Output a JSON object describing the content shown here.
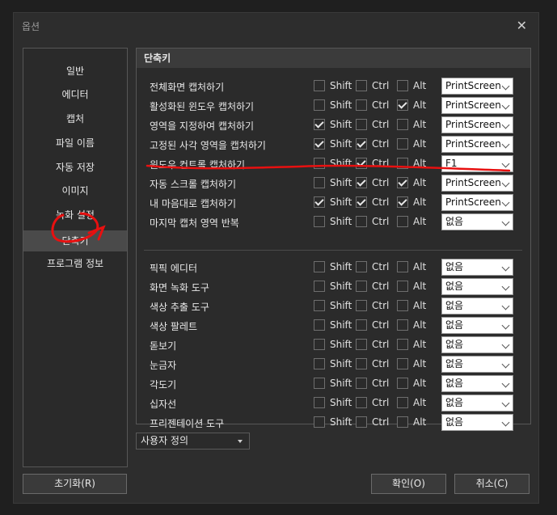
{
  "window": {
    "title": "옵션",
    "close_glyph": "✕"
  },
  "sidebar": {
    "items": [
      {
        "label": "일반",
        "active": false
      },
      {
        "label": "에디터",
        "active": false
      },
      {
        "label": "캡처",
        "active": false
      },
      {
        "label": "파일 이름",
        "active": false
      },
      {
        "label": "자동 저장",
        "active": false
      },
      {
        "label": "이미지",
        "active": false
      },
      {
        "label": "녹화 설정",
        "active": false
      },
      {
        "label": "단축키",
        "active": true
      },
      {
        "label": "프로그램 정보",
        "active": false
      }
    ]
  },
  "panel": {
    "title": "단축키",
    "modifier_labels": {
      "shift": "Shift",
      "ctrl": "Ctrl",
      "alt": "Alt"
    },
    "capture_rows": [
      {
        "label": "전체화면 캡처하기",
        "shift": false,
        "ctrl": false,
        "alt": false,
        "key": "PrintScreen"
      },
      {
        "label": "활성화된 윈도우 캡처하기",
        "shift": false,
        "ctrl": false,
        "alt": true,
        "key": "PrintScreen"
      },
      {
        "label": "영역을 지정하여 캡처하기",
        "shift": true,
        "ctrl": false,
        "alt": false,
        "key": "PrintScreen"
      },
      {
        "label": "고정된 사각 영역을 캡처하기",
        "shift": true,
        "ctrl": true,
        "alt": false,
        "key": "PrintScreen"
      },
      {
        "label": "윈도우 컨트롤 캡처하기",
        "shift": false,
        "ctrl": true,
        "alt": false,
        "key": "F1"
      },
      {
        "label": "자동 스크롤 캡처하기",
        "shift": false,
        "ctrl": true,
        "alt": true,
        "key": "PrintScreen"
      },
      {
        "label": "내 마음대로 캡처하기",
        "shift": true,
        "ctrl": true,
        "alt": true,
        "key": "PrintScreen"
      },
      {
        "label": "마지막 캡처 영역 반복",
        "shift": false,
        "ctrl": false,
        "alt": false,
        "key": "없음"
      }
    ],
    "tool_rows": [
      {
        "label": "픽픽 에디터",
        "shift": false,
        "ctrl": false,
        "alt": false,
        "key": "없음"
      },
      {
        "label": "화면 녹화 도구",
        "shift": false,
        "ctrl": false,
        "alt": false,
        "key": "없음"
      },
      {
        "label": "색상 추출 도구",
        "shift": false,
        "ctrl": false,
        "alt": false,
        "key": "없음"
      },
      {
        "label": "색상 팔레트",
        "shift": false,
        "ctrl": false,
        "alt": false,
        "key": "없음"
      },
      {
        "label": "돋보기",
        "shift": false,
        "ctrl": false,
        "alt": false,
        "key": "없음"
      },
      {
        "label": "눈금자",
        "shift": false,
        "ctrl": false,
        "alt": false,
        "key": "없음"
      },
      {
        "label": "각도기",
        "shift": false,
        "ctrl": false,
        "alt": false,
        "key": "없음"
      },
      {
        "label": "십자선",
        "shift": false,
        "ctrl": false,
        "alt": false,
        "key": "없음"
      },
      {
        "label": "프리젠테이션 도구",
        "shift": false,
        "ctrl": false,
        "alt": false,
        "key": "없음"
      }
    ]
  },
  "preset_select": {
    "value": "사용자 정의"
  },
  "buttons": {
    "reset": "초기화(R)",
    "ok": "확인(O)",
    "cancel": "취소(C)"
  },
  "colors": {
    "annotation": "#e81010",
    "background": "#2d2d2d"
  }
}
